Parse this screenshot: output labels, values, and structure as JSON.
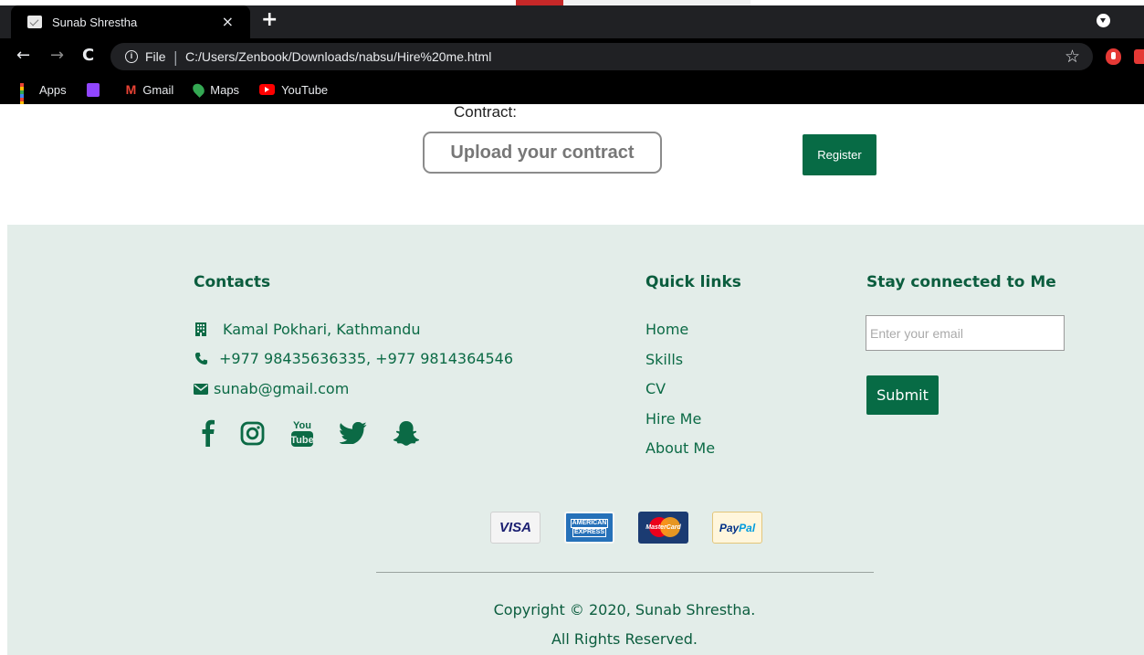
{
  "browser": {
    "tab_title": "Sunab Shrestha",
    "tab_close": "×",
    "new_tab": "+",
    "url_scheme": "File",
    "url_separator": "|",
    "url": "C:/Users/Zenbook/Downloads/nabsu/Hire%20me.html",
    "bookmarks": [
      {
        "label": "Apps",
        "icon": "apps-grid-icon"
      },
      {
        "label": "",
        "icon": "twitch-icon"
      },
      {
        "label": "Gmail",
        "icon": "gmail-icon"
      },
      {
        "label": "Maps",
        "icon": "maps-icon"
      },
      {
        "label": "YouTube",
        "icon": "youtube-icon"
      }
    ]
  },
  "form": {
    "contract_label": "Contract:",
    "upload_label": "Upload your contract",
    "register_label": "Register"
  },
  "footer": {
    "contacts": {
      "title": "Contacts",
      "address": "Kamal Pokhari, Kathmandu",
      "phone": "+977 98435636335, +977 9814364546",
      "email": "sunab@gmail.com",
      "social": [
        "facebook-icon",
        "instagram-icon",
        "youtube-icon",
        "twitter-icon",
        "snapchat-icon"
      ]
    },
    "quick_links": {
      "title": "Quick links",
      "items": [
        "Home",
        "Skills",
        "CV",
        "Hire Me",
        "About Me"
      ]
    },
    "stay_connected": {
      "title": "Stay connected to Me",
      "email_placeholder": "Enter your email",
      "submit_label": "Submit"
    },
    "payments": {
      "visa": "VISA",
      "amex_line1": "AMERICAN",
      "amex_line2": "EXPRESS",
      "mastercard": "MasterCard",
      "paypal_part1": "Pay",
      "paypal_part2": "Pal"
    },
    "copyright_line1": "Copyright © 2020, Sunab Shrestha.",
    "copyright_line2": "All Rights Reserved."
  },
  "colors": {
    "brand_green": "#076b45",
    "footer_bg": "#e3ede9",
    "text_green": "#0b6a45"
  }
}
